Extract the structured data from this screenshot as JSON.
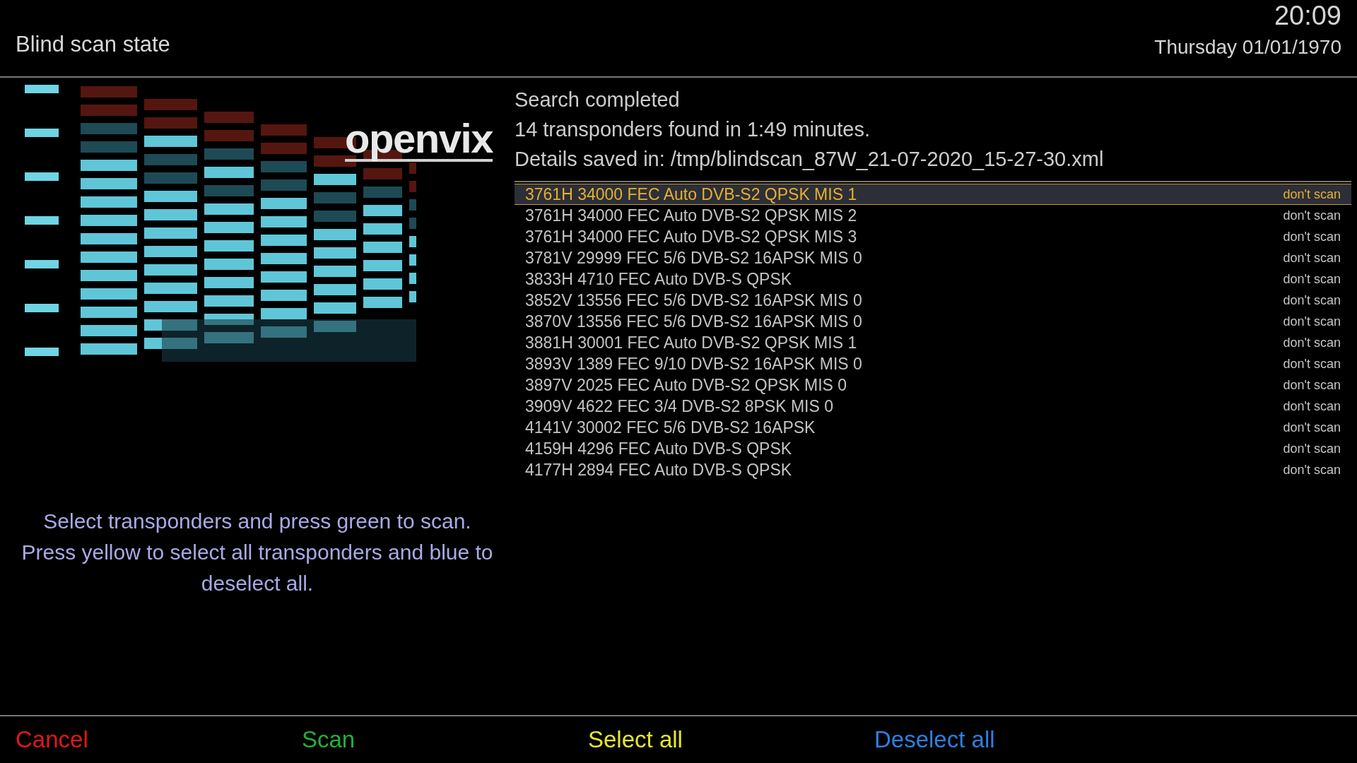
{
  "header": {
    "title": "Blind scan state",
    "clock": "20:09",
    "date": "Thursday 01/01/1970"
  },
  "logo": {
    "text": "openvix"
  },
  "result": {
    "lines": [
      "Search completed",
      "14 transponders found in 1:49 minutes.",
      "Details saved in: /tmp/blindscan_87W_21-07-2020_15-27-30.xml"
    ]
  },
  "transponders": [
    {
      "label": "3761H 34000 FEC Auto DVB-S2 QPSK MIS 1",
      "status": "don't scan",
      "selected": true
    },
    {
      "label": "3761H 34000 FEC Auto DVB-S2 QPSK MIS 2",
      "status": "don't scan",
      "selected": false
    },
    {
      "label": "3761H 34000 FEC Auto DVB-S2 QPSK MIS 3",
      "status": "don't scan",
      "selected": false
    },
    {
      "label": "3781V 29999 FEC 5/6 DVB-S2 16APSK MIS 0",
      "status": "don't scan",
      "selected": false
    },
    {
      "label": "3833H 4710 FEC Auto DVB-S QPSK",
      "status": "don't scan",
      "selected": false
    },
    {
      "label": "3852V 13556 FEC 5/6 DVB-S2 16APSK MIS 0",
      "status": "don't scan",
      "selected": false
    },
    {
      "label": "3870V 13556 FEC 5/6 DVB-S2 16APSK MIS 0",
      "status": "don't scan",
      "selected": false
    },
    {
      "label": "3881H 30001 FEC Auto DVB-S2 QPSK MIS 1",
      "status": "don't scan",
      "selected": false
    },
    {
      "label": "3893V 1389 FEC 9/10 DVB-S2 16APSK MIS 0",
      "status": "don't scan",
      "selected": false
    },
    {
      "label": "3897V 2025 FEC Auto DVB-S2 QPSK MIS 0",
      "status": "don't scan",
      "selected": false
    },
    {
      "label": "3909V 4622 FEC 3/4 DVB-S2 8PSK MIS 0",
      "status": "don't scan",
      "selected": false
    },
    {
      "label": "4141V 30002 FEC 5/6 DVB-S2 16APSK",
      "status": "don't scan",
      "selected": false
    },
    {
      "label": "4159H 4296 FEC Auto DVB-S QPSK",
      "status": "don't scan",
      "selected": false
    },
    {
      "label": "4177H 2894 FEC Auto DVB-S QPSK",
      "status": "don't scan",
      "selected": false
    }
  ],
  "help": "Select transponders and press green to scan. Press yellow to select all transponders and blue to deselect all.",
  "buttons": [
    {
      "label": "Cancel",
      "color": "#e01818"
    },
    {
      "label": "Scan",
      "color": "#22b03a"
    },
    {
      "label": "Select all",
      "color": "#e6e632"
    },
    {
      "label": "Deselect all",
      "color": "#2f7fe0"
    }
  ]
}
